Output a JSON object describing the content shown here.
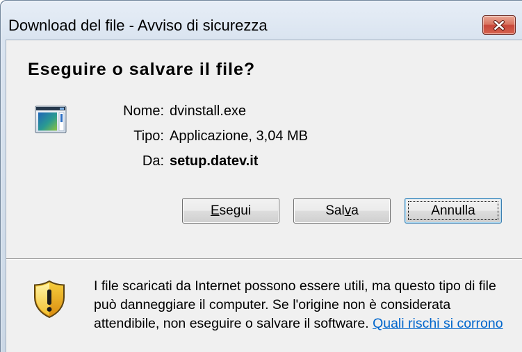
{
  "window": {
    "title": "Download del file - Avviso di sicurezza",
    "close_icon": "close-icon"
  },
  "dialog": {
    "question": "Eseguire o salvare il file?",
    "file_icon": "application-icon",
    "fields": [
      {
        "label": "Nome:",
        "value": "dvinstall.exe"
      },
      {
        "label": "Tipo:",
        "value": "Applicazione, 3,04 MB"
      },
      {
        "label": "Da:",
        "value": "setup.datev.it"
      }
    ],
    "buttons": {
      "run": {
        "label": "Esegui",
        "access_key_index": 0,
        "focused": false
      },
      "save": {
        "label": "Salva",
        "access_key_index": 3,
        "focused": false
      },
      "cancel": {
        "label": "Annulla",
        "access_key_index": null,
        "focused": true
      }
    }
  },
  "warning": {
    "icon": "warning-shield-icon",
    "lines": [
      "I file scaricati da Internet possono essere utili, ma questo tipo di file",
      "può danneggiare il computer. Se l'origine non è considerata",
      "attendibile, non eseguire o salvare il software."
    ],
    "link": "Quali rischi si corrono"
  },
  "colors": {
    "title_bar": "#dae4f0",
    "close_button": "#c8473a",
    "dialog_background": "#f0f0f0",
    "default_button_border": "#3c7fb1",
    "link": "#0066cc"
  }
}
